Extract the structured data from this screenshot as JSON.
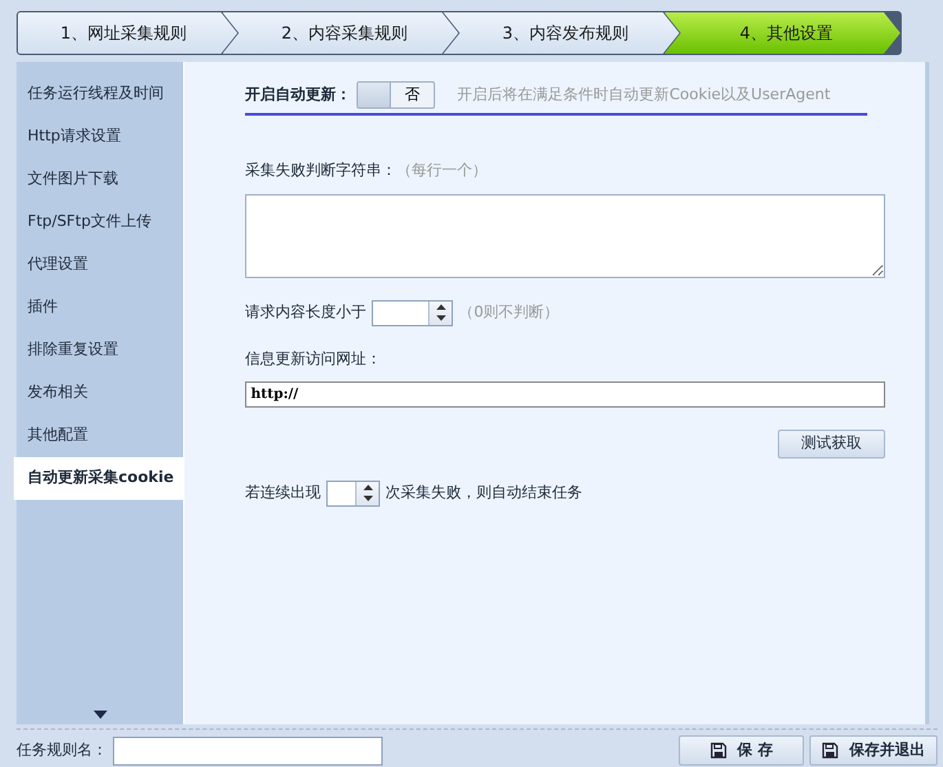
{
  "steps": [
    {
      "label": "1、网址采集规则",
      "selected": false
    },
    {
      "label": "2、内容采集规则",
      "selected": false
    },
    {
      "label": "3、内容发布规则",
      "selected": false
    },
    {
      "label": "4、其他设置",
      "selected": true
    }
  ],
  "sidebar": {
    "items": [
      {
        "label": "任务运行线程及时间",
        "selected": false
      },
      {
        "label": "Http请求设置",
        "selected": false
      },
      {
        "label": "文件图片下载",
        "selected": false
      },
      {
        "label": "Ftp/SFtp文件上传",
        "selected": false
      },
      {
        "label": "代理设置",
        "selected": false
      },
      {
        "label": "插件",
        "selected": false
      },
      {
        "label": "排除重复设置",
        "selected": false
      },
      {
        "label": "发布相关",
        "selected": false
      },
      {
        "label": "其他配置",
        "selected": false
      },
      {
        "label": "自动更新采集cookie",
        "selected": true
      }
    ]
  },
  "auto_update": {
    "label": "开启自动更新：",
    "on": false,
    "state_text": "否",
    "hint": "开启后将在满足条件时自动更新Cookie以及UserAgent"
  },
  "fail_strings": {
    "label": "采集失败判断字符串：",
    "hint": "（每行一个）"
  },
  "min_length": {
    "label": "请求内容长度小于",
    "hint": "（0则不判断）"
  },
  "url": {
    "label": "信息更新访问网址：",
    "value": "http://"
  },
  "test_button": "测试获取",
  "consecutive": {
    "prefix": "若连续出现",
    "suffix": "次采集失败，则自动结束任务"
  },
  "footer": {
    "name_label": "任务规则名：",
    "buttons": [
      "保 存",
      "保存并退出"
    ]
  }
}
